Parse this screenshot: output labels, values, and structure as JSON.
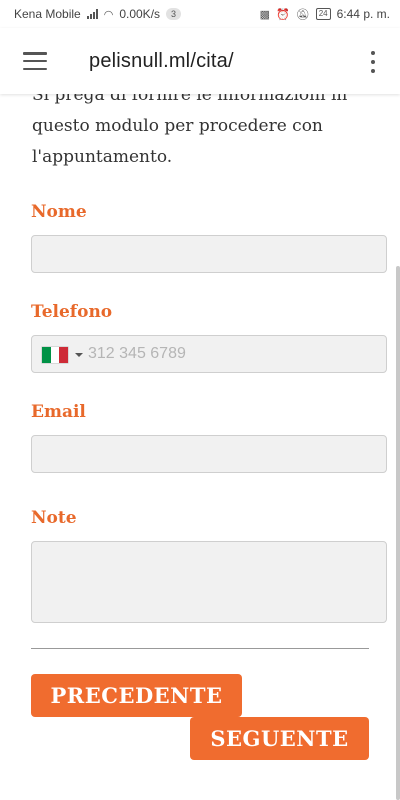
{
  "status_bar": {
    "carrier": "Kena Mobile",
    "speed": "0.00K/s",
    "notification_count": "3",
    "battery": "24",
    "time": "6:44 p. m."
  },
  "browser": {
    "url": "pelisnull.ml/cita/"
  },
  "form": {
    "intro": "Si prega di fornire le informazioni in questo modulo per procedere con l'appuntamento.",
    "fields": {
      "nome": {
        "label": "Nome",
        "value": ""
      },
      "telefono": {
        "label": "Telefono",
        "placeholder": "312 345 6789",
        "country": "Italy",
        "flag_colors": [
          "#009246",
          "#ffffff",
          "#ce2b37"
        ]
      },
      "email": {
        "label": "Email",
        "value": ""
      },
      "note": {
        "label": "Note",
        "value": ""
      }
    },
    "buttons": {
      "previous": "PRECEDENTE",
      "next": "SEGUENTE"
    }
  },
  "colors": {
    "accent": "#f06c2f",
    "label": "#e8692b"
  },
  "icons": {
    "menu": "hamburger-menu-icon",
    "more": "more-vert-icon",
    "flag": "italy-flag-icon"
  }
}
